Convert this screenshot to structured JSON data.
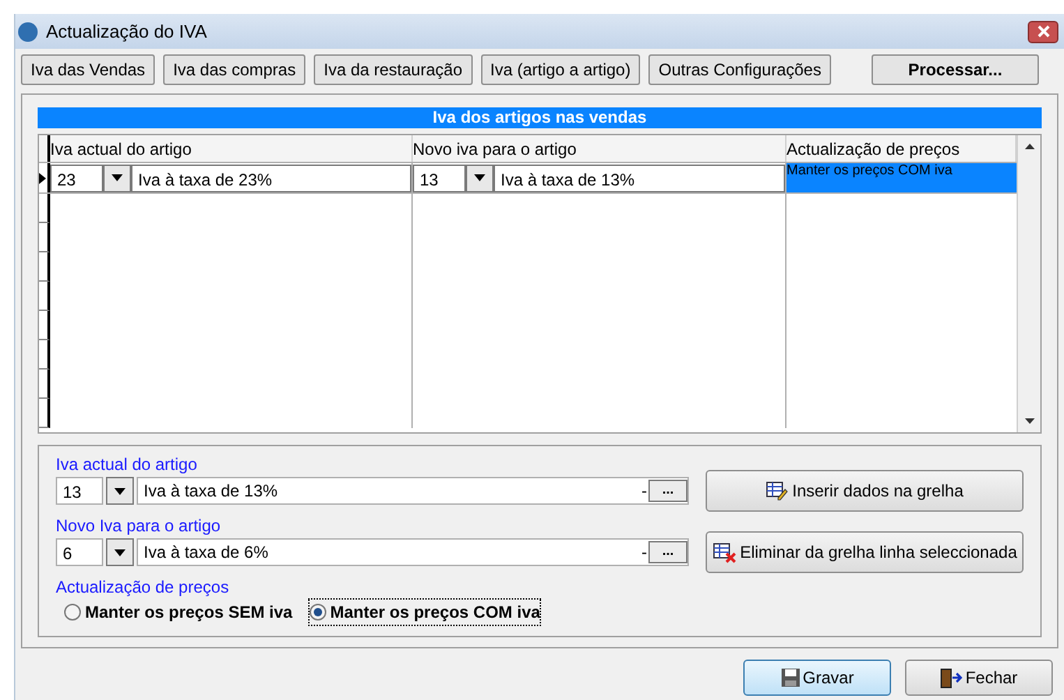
{
  "window": {
    "title": "Actualização do IVA"
  },
  "toolbar": [
    {
      "label": "Iva das Vendas",
      "selected": false
    },
    {
      "label": "Iva das compras",
      "selected": false
    },
    {
      "label": "Iva da restauração",
      "selected": false
    },
    {
      "label": "Iva (artigo a artigo)",
      "selected": false
    },
    {
      "label": "Outras Configurações",
      "selected": false
    }
  ],
  "process_button": "Processar...",
  "section_title": "Iva dos artigos nas vendas",
  "grid": {
    "columns": [
      "Iva actual do artigo",
      "Novo iva para o artigo",
      "Actualização de preços"
    ],
    "rows": [
      {
        "current_code": "23",
        "current_desc": "Iva à taxa de 23%",
        "new_code": "13",
        "new_desc": "Iva à taxa de 13%",
        "price_update": "Manter os preços COM iva",
        "selected": true
      }
    ]
  },
  "form": {
    "current_label": "Iva actual do artigo",
    "current_code": "13",
    "current_desc": "Iva à taxa de 13%",
    "current_dash": "-",
    "new_label": "Novo Iva para o artigo",
    "new_code": "6",
    "new_desc": "Iva à taxa de 6%",
    "new_dash": "-",
    "browse_label": "...",
    "insert_button": "Inserir dados na grelha",
    "delete_button": "Eliminar da grelha linha seleccionada",
    "price_label": "Actualização de preços",
    "options": [
      {
        "label": "Manter os preços SEM iva",
        "selected": false
      },
      {
        "label": "Manter os preços COM iva",
        "selected": true
      }
    ]
  },
  "footer": {
    "save": "Gravar",
    "close": "Fechar"
  }
}
